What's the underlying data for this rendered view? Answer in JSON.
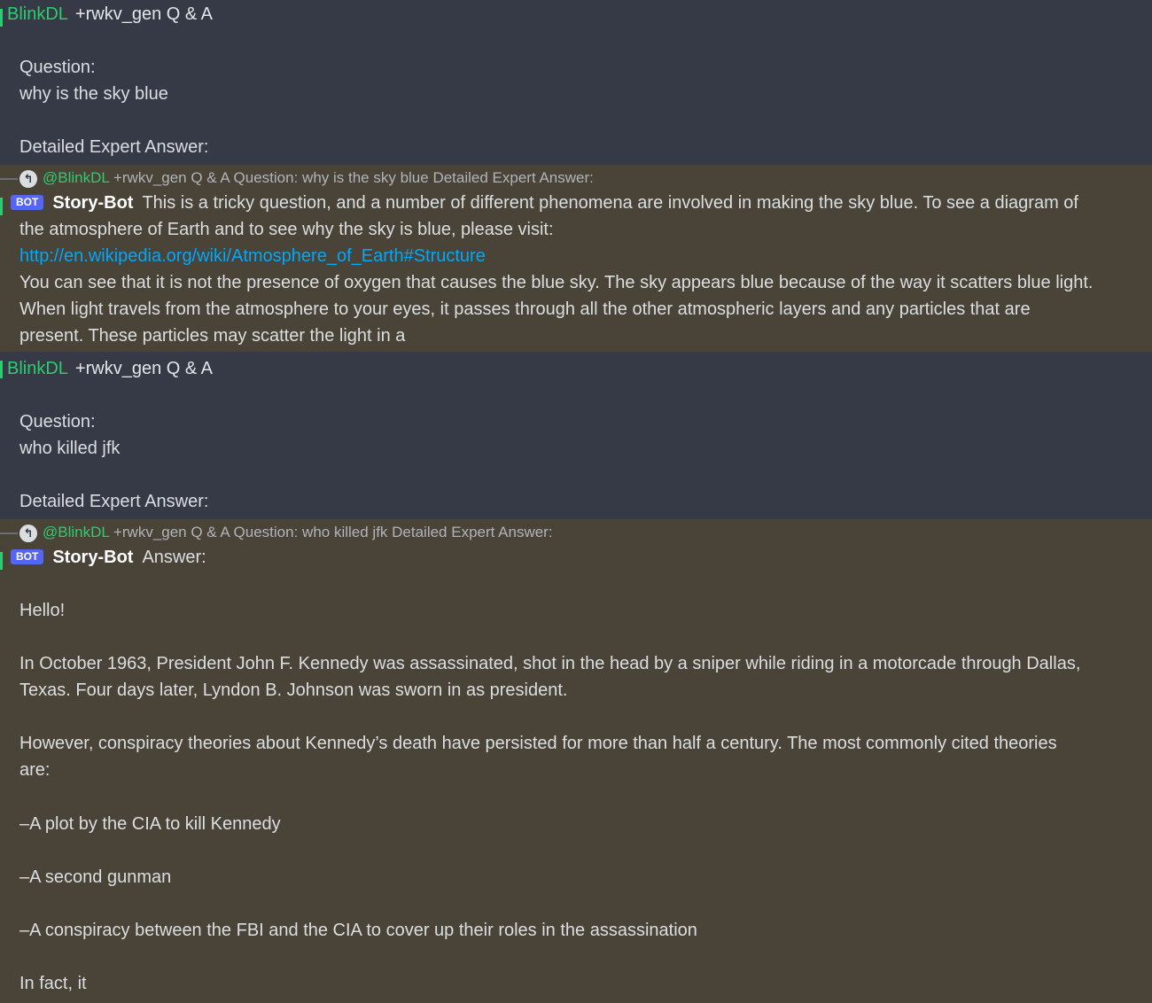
{
  "messages": [
    {
      "author": "BlinkDL",
      "command": "+rwkv_gen Q & A",
      "lines": [
        "Question:",
        "why is the sky blue",
        "Detailed Expert Answer:"
      ]
    },
    {
      "reply": {
        "mention": "@BlinkDL",
        "text": "+rwkv_gen Q & A Question: why is the sky blue Detailed Expert Answer:"
      },
      "badge": "BOT",
      "author": "Story-Bot",
      "first_line": "This is a tricky question, and a number of different phenomena are involved in making the sky blue. To see a diagram of",
      "lines": [
        "the atmosphere of Earth and to see why the sky is blue, please visit:",
        "You can see that it is not the presence of oxygen that causes the blue sky. The sky appears blue because of the way it scatters blue light.",
        "When light travels from the atmosphere to your eyes, it passes through all the other atmospheric layers and any particles that are",
        "present. These particles may scatter the light in a"
      ],
      "link": "http://en.wikipedia.org/wiki/Atmosphere_of_Earth#Structure"
    },
    {
      "author": "BlinkDL",
      "command": "+rwkv_gen Q & A",
      "lines": [
        "Question:",
        "who killed jfk",
        "Detailed Expert Answer:"
      ]
    },
    {
      "reply": {
        "mention": "@BlinkDL",
        "text": "+rwkv_gen Q & A Question: who killed jfk Detailed Expert Answer:"
      },
      "badge": "BOT",
      "author": "Story-Bot",
      "first_line": "Answer:",
      "lines": [
        "Hello!",
        "In October 1963, President John F. Kennedy was assassinated, shot in the head by a sniper while riding in a motorcade through Dallas,",
        "Texas. Four days later, Lyndon B. Johnson was sworn in as president.",
        "However, conspiracy theories about Kennedy’s death have persisted for more than half a century. The most commonly cited theories",
        "are:",
        "–A plot by the CIA to kill Kennedy",
        "–A second gunman",
        "–A conspiracy between the FBI and the CIA to cover up their roles in the assassination",
        "In fact, it"
      ]
    }
  ]
}
